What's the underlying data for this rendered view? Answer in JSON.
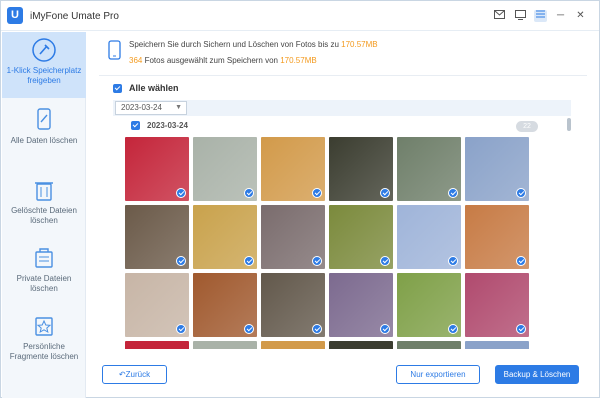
{
  "app": {
    "title": "iMyFone Umate Pro",
    "logo_letter": "U"
  },
  "titlebar": {
    "mail_icon": "mail-icon",
    "feedback_icon": "screen-icon",
    "menu_icon": "menu-icon",
    "minimize": "─",
    "close": "✕"
  },
  "sidebar": {
    "items": [
      {
        "label": "1-Klick Speicherplatz freigeben",
        "icon": "broom-icon",
        "active": true
      },
      {
        "label": "Alle Daten löschen",
        "icon": "phone-erase-icon",
        "active": false
      },
      {
        "label": "Gelöschte Dateien löschen",
        "icon": "trash-icon",
        "active": false
      },
      {
        "label": "Private Dateien löschen",
        "icon": "private-folder-icon",
        "active": false
      },
      {
        "label": "Persönliche Fragmente löschen",
        "icon": "fragment-icon",
        "active": false
      }
    ]
  },
  "info": {
    "line1_prefix": "Speichern Sie durch Sichern und Löschen von Fotos bis zu",
    "line1_value": "170.57MB",
    "line2_count": "364",
    "line2_middle": "Fotos ausgewählt zum Speichern von",
    "line2_value": "170.57MB"
  },
  "select_all": {
    "label": "Alle wählen",
    "checked": true
  },
  "date_filter": {
    "selected": "2023-03-24"
  },
  "group": {
    "date": "2023-03-24",
    "count": "22",
    "checked": true
  },
  "photos": [
    "#c4253a",
    "#a9b2a8",
    "#d29a4a",
    "#3b3d30",
    "#6f7f6a",
    "#8aa2c9",
    "#6b5a49",
    "#c9a24c",
    "#7a6c6d",
    "#7b8a3c",
    "#9fb4d9",
    "#c77b45",
    "#c7b5a6",
    "#a0592e",
    "#62584b",
    "#7c6a8f",
    "#7fa048",
    "#b04a6e"
  ],
  "buttons": {
    "back": "Zurück",
    "export": "Nur exportieren",
    "backup": "Backup & Löschen"
  },
  "colors": {
    "accent": "#2d7be5",
    "highlight": "#f39a1e"
  }
}
